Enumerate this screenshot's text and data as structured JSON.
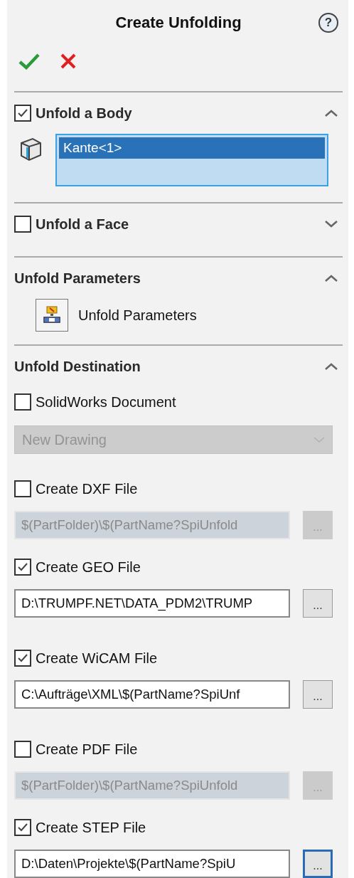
{
  "title": "Create Unfolding",
  "help_label": "?",
  "sections": [
    {
      "kind": "checkbox",
      "title": "Unfold a Body",
      "checked": true,
      "expanded": true,
      "content": {
        "kind": "selection",
        "items": [
          {
            "label": "Kante<1>",
            "selected": true
          }
        ]
      }
    },
    {
      "kind": "checkbox",
      "title": "Unfold a Face",
      "checked": false,
      "expanded": false
    },
    {
      "kind": "plain",
      "title": "Unfold Parameters",
      "expanded": true,
      "content": {
        "kind": "button",
        "label": "Unfold Parameters"
      }
    },
    {
      "kind": "plain",
      "title": "Unfold Destination",
      "expanded": true,
      "content": {
        "kind": "destinations",
        "items": [
          {
            "kind": "dropdown",
            "label": "SolidWorks Document",
            "checked": false,
            "value": "New Drawing"
          },
          {
            "kind": "file",
            "label": "Create DXF File",
            "checked": false,
            "path": "$(PartFolder)\\$(PartName?SpiUnfold",
            "browse": "...",
            "focused": false
          },
          {
            "kind": "file",
            "label": "Create GEO File",
            "checked": true,
            "path": "D:\\TRUMPF.NET\\DATA_PDM2\\TRUMP",
            "browse": "...",
            "focused": false
          },
          {
            "kind": "file",
            "label": "Create WiCAM File",
            "checked": true,
            "path": "C:\\Aufträge\\XML\\$(PartName?SpiUnf",
            "browse": "...",
            "focused": false
          },
          {
            "kind": "file",
            "label": "Create PDF File",
            "checked": false,
            "path": "$(PartFolder)\\$(PartName?SpiUnfold",
            "browse": "...",
            "focused": false
          },
          {
            "kind": "file",
            "label": "Create STEP File",
            "checked": true,
            "path": "D:\\Daten\\Projekte\\$(PartName?SpiU",
            "browse": "...",
            "focused": true
          }
        ]
      }
    }
  ]
}
